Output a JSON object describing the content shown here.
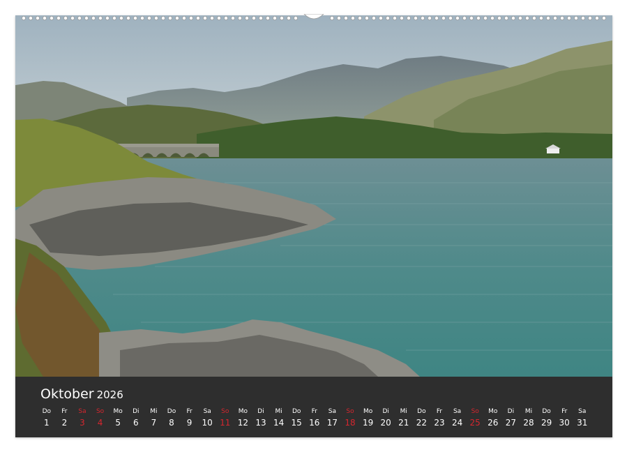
{
  "calendar": {
    "month": "Oktober",
    "year": "2026",
    "days": [
      {
        "wd": "Do",
        "n": "1",
        "weekend": false
      },
      {
        "wd": "Fr",
        "n": "2",
        "weekend": false
      },
      {
        "wd": "Sa",
        "n": "3",
        "weekend": true
      },
      {
        "wd": "So",
        "n": "4",
        "weekend": true
      },
      {
        "wd": "Mo",
        "n": "5",
        "weekend": false
      },
      {
        "wd": "Di",
        "n": "6",
        "weekend": false
      },
      {
        "wd": "Mi",
        "n": "7",
        "weekend": false
      },
      {
        "wd": "Do",
        "n": "8",
        "weekend": false
      },
      {
        "wd": "Fr",
        "n": "9",
        "weekend": false
      },
      {
        "wd": "Sa",
        "n": "10",
        "weekend": false
      },
      {
        "wd": "So",
        "n": "11",
        "weekend": true
      },
      {
        "wd": "Mo",
        "n": "12",
        "weekend": false
      },
      {
        "wd": "Di",
        "n": "13",
        "weekend": false
      },
      {
        "wd": "Mi",
        "n": "14",
        "weekend": false
      },
      {
        "wd": "Do",
        "n": "15",
        "weekend": false
      },
      {
        "wd": "Fr",
        "n": "16",
        "weekend": false
      },
      {
        "wd": "Sa",
        "n": "17",
        "weekend": false
      },
      {
        "wd": "So",
        "n": "18",
        "weekend": true
      },
      {
        "wd": "Mo",
        "n": "19",
        "weekend": false
      },
      {
        "wd": "Di",
        "n": "20",
        "weekend": false
      },
      {
        "wd": "Mi",
        "n": "21",
        "weekend": false
      },
      {
        "wd": "Do",
        "n": "22",
        "weekend": false
      },
      {
        "wd": "Fr",
        "n": "23",
        "weekend": false
      },
      {
        "wd": "Sa",
        "n": "24",
        "weekend": false
      },
      {
        "wd": "So",
        "n": "25",
        "weekend": true
      },
      {
        "wd": "Mo",
        "n": "26",
        "weekend": false
      },
      {
        "wd": "Di",
        "n": "27",
        "weekend": false
      },
      {
        "wd": "Mi",
        "n": "28",
        "weekend": false
      },
      {
        "wd": "Do",
        "n": "29",
        "weekend": false
      },
      {
        "wd": "Fr",
        "n": "30",
        "weekend": false
      },
      {
        "wd": "Sa",
        "n": "31",
        "weekend": false
      }
    ]
  },
  "colors": {
    "weekend": "#d6262e",
    "calendar_bg": "#2e2e2e",
    "text": "#ffffff"
  }
}
